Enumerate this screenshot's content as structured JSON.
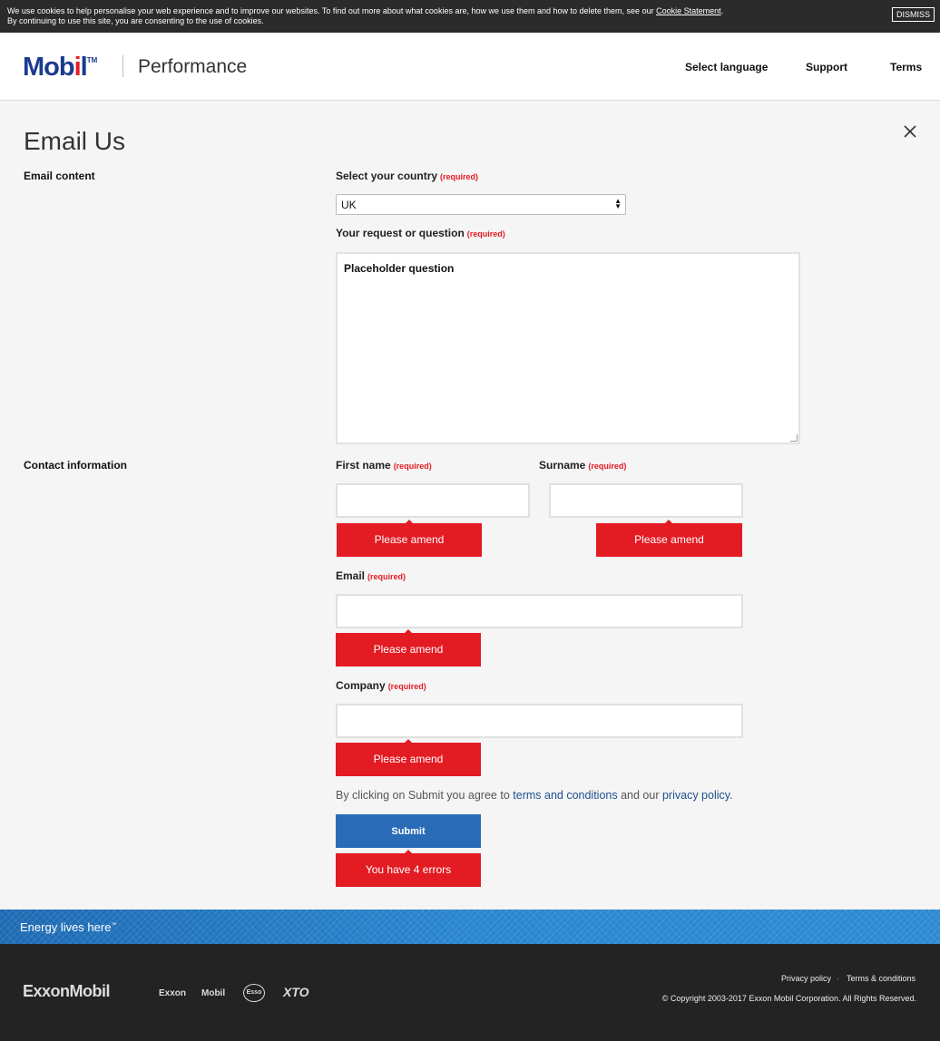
{
  "cookie": {
    "line1": "We use cookies to help personalise your web experience and to improve our websites. To find out more about what cookies are, how we use them and how to delete them, see our",
    "link": "Cookie Statement",
    "period": ".",
    "line2": "By continuing to use this site, you are consenting to the use of cookies.",
    "dismiss": "DISMISS"
  },
  "header": {
    "logo_main": "Mob",
    "logo_red": "i",
    "logo_end": "l",
    "logo_tm": "TM",
    "subtitle": "Performance",
    "nav": {
      "language": "Select language",
      "support": "Support",
      "terms": "Terms"
    }
  },
  "page": {
    "title": "Email Us"
  },
  "form": {
    "required_tag": "(required)",
    "email_content_label": "Email content",
    "contact_info_label": "Contact information",
    "country_label": "Select your country",
    "country_value": "UK",
    "question_label": "Your request or question",
    "question_value": "Placeholder question",
    "first_name_label": "First name",
    "surname_label": "Surname",
    "email_label": "Email",
    "company_label": "Company",
    "error_text": "Please amend",
    "agree_prefix": "By clicking on Submit you agree to",
    "agree_terms": "terms and conditions",
    "agree_mid": "and our",
    "agree_privacy": "privacy policy",
    "agree_suffix": ".",
    "submit_label": "Submit",
    "summary_error": "You have 4 errors"
  },
  "footer": {
    "tagline": "Energy lives here",
    "tagline_tm": "™",
    "corp_logo": "ExxonMobil",
    "brands": {
      "exxon": "Exxon",
      "mobil": "Mobil",
      "esso": "Esso",
      "xto": "XTO"
    },
    "privacy": "Privacy policy",
    "separator": "·",
    "terms": "Terms & conditions",
    "copyright": "© Copyright 2003-2017 Exxon Mobil Corporation. All Rights Reserved."
  },
  "colors": {
    "brand_blue": "#1a3b8f",
    "brand_red": "#e31b23",
    "submit_blue": "#2a6bb8",
    "link_blue": "#1e4f8f"
  }
}
